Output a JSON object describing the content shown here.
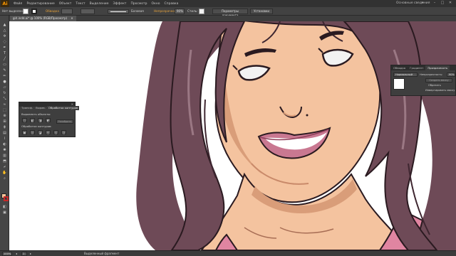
{
  "app": {
    "logo": "Ai",
    "workspace": "Основные сведения",
    "workspace_chevron": "▾"
  },
  "menu": [
    "Файл",
    "Редактирование",
    "Объект",
    "Текст",
    "Выделение",
    "Эффект",
    "Просмотр",
    "Окно",
    "Справка"
  ],
  "window_controls": {
    "minimize": "–",
    "maximize": "□",
    "close": "✕"
  },
  "control_bar": {
    "selection_label": "Нет выделения",
    "stroke_label": "Обводка",
    "stroke_preview_label": "Базовая",
    "opacity_label": "Непрозрачность",
    "opacity_value": "90%",
    "style_label": "Стиль:",
    "document_setup_button": "Параметры документа",
    "preferences_button": "Установки",
    "fill_color": "#ffffff",
    "stroke_color": "#222222"
  },
  "document_tab": {
    "title": "girl.indd.ai* @ 100% (RGB/Просмотр)",
    "close": "✕"
  },
  "left_panel": {
    "tabs": [
      "Трансф.",
      "Вырав.",
      "Обработка контуров"
    ],
    "active_tab": 2,
    "align_section": "Выровнять объекты:",
    "pathfinder_section": "Обработка контуров:",
    "expand_button": "Разобрать",
    "close": "✕",
    "shape_mode_buttons": [
      "◻",
      "◧",
      "◨",
      "◩"
    ],
    "pathfinder_buttons": [
      "▣",
      "◫",
      "◪",
      "◰",
      "◱",
      "◲"
    ]
  },
  "right_panel": {
    "tabs": [
      "Обводка",
      "Градиент",
      "Прозрачность"
    ],
    "active_tab": 2,
    "blend_mode": "Нормальный",
    "opacity_label": "Непрозрачность:",
    "opacity_value": "90%",
    "make_mask_button": "Создать маску",
    "clip_label": "Обрезать",
    "invert_label": "Инвертировать маску"
  },
  "status_bar": {
    "zoom": "100%",
    "page_prev": "◂",
    "page_number": "1",
    "page_next": "▸",
    "selection_info": "Выделенный фрагмент"
  },
  "tools": [
    "selection",
    "direct-selection",
    "magic-wand",
    "lasso",
    "pen",
    "type",
    "line",
    "rectangle",
    "paintbrush",
    "pencil",
    "blob-brush",
    "eraser",
    "rotate",
    "scale",
    "warp",
    "free-transform",
    "shape-builder",
    "perspective-grid",
    "mesh",
    "gradient",
    "eyedropper",
    "blend",
    "symbol-sprayer",
    "column-graph",
    "artboard",
    "slice",
    "hand",
    "zoom"
  ],
  "artwork_colors": {
    "hair": "#6e4a57",
    "hair_shadow": "#3e2630",
    "hair_highlight": "#9b7884",
    "skin": "#f4c39f",
    "skin_shadow": "#d99d79",
    "lips": "#c97891",
    "lips_dark": "#8e3f5a",
    "eye_white": "#f2f2f2",
    "outline": "#2a1a20",
    "shirt": "#e085a1"
  }
}
